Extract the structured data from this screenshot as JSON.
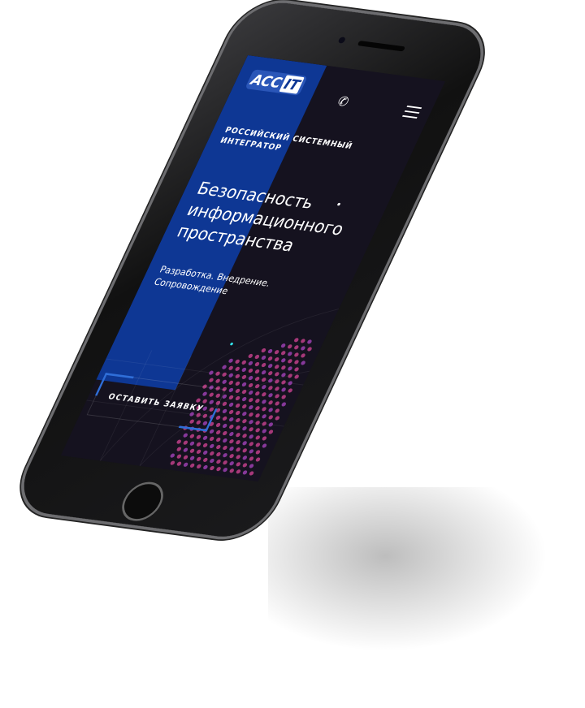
{
  "header": {
    "logo_left": "ACC",
    "logo_right": "IT",
    "phone_icon": "phone-icon",
    "menu_icon": "hamburger-icon"
  },
  "hero": {
    "subtitle": "РОССИЙСКИЙ СИСТЕМНЫЙ ИНТЕГРАТОР",
    "title": "Безопасность информационного пространства",
    "description": "Разработка.  Внедрение. Сопровождение",
    "cta": "ОСТАВИТЬ ЗАЯВКУ"
  },
  "colors": {
    "brand_blue": "#0e3794",
    "background": "#15121f",
    "accent_cyan": "#33e0e8",
    "dots": "#c0408a"
  }
}
